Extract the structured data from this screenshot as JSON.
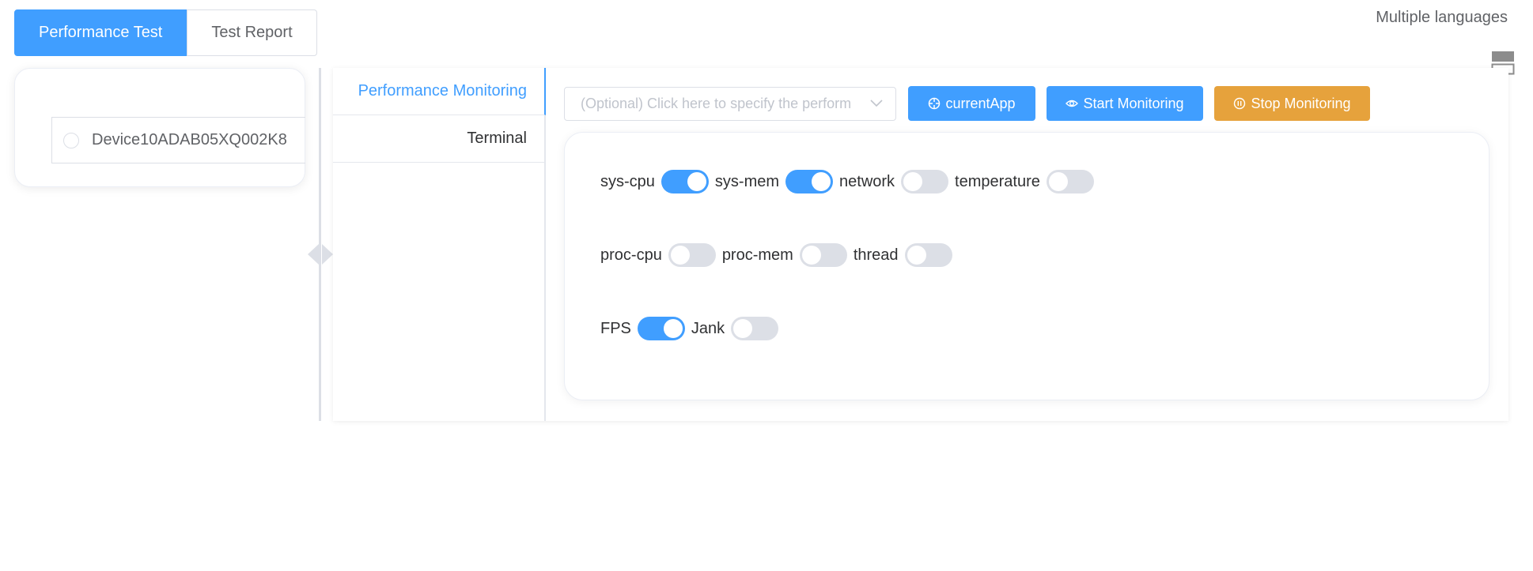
{
  "top_tabs": [
    {
      "label": "Performance Test",
      "active": true
    },
    {
      "label": "Test Report",
      "active": false
    }
  ],
  "language_label": "Multiple languages",
  "device": {
    "label": "Device10ADAB05XQ002K8"
  },
  "side_tabs": [
    {
      "label": "Performance Monitoring",
      "active": true
    },
    {
      "label": "Terminal",
      "active": false
    }
  ],
  "toolbar": {
    "select_placeholder": "(Optional) Click here to specify the perform",
    "current_app_label": "currentApp",
    "start_label": "Start Monitoring",
    "stop_label": "Stop Monitoring"
  },
  "metrics": [
    {
      "label": "sys-cpu",
      "on": true
    },
    {
      "label": "sys-mem",
      "on": true
    },
    {
      "label": "network",
      "on": false
    },
    {
      "label": "temperature",
      "on": false
    },
    {
      "label": "proc-cpu",
      "on": false
    },
    {
      "label": "proc-mem",
      "on": false
    },
    {
      "label": "thread",
      "on": false
    },
    {
      "label": "FPS",
      "on": true
    },
    {
      "label": "Jank",
      "on": false
    }
  ],
  "colors": {
    "primary": "#409eff",
    "warning": "#e6a23c"
  }
}
